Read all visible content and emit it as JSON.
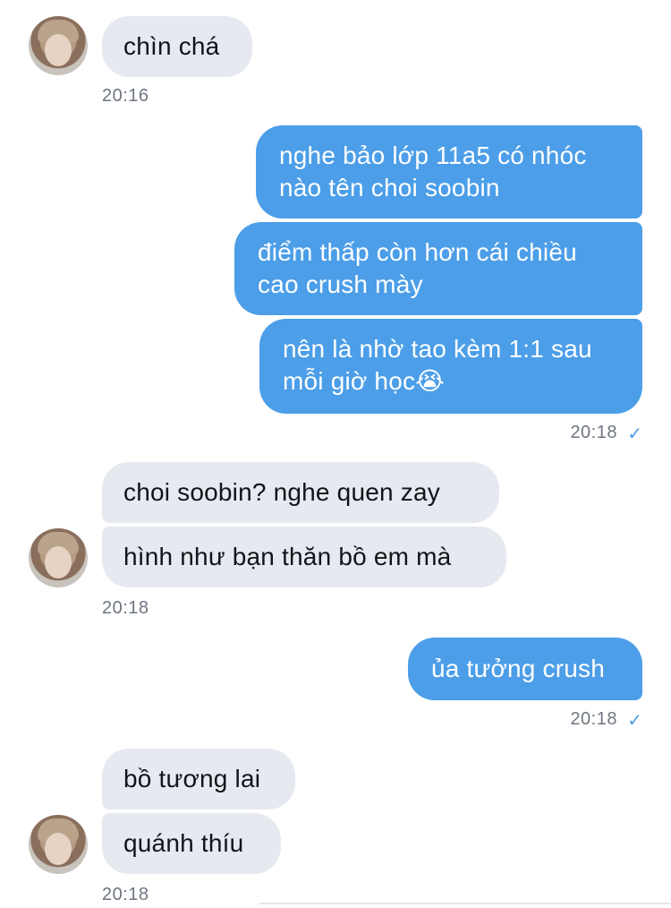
{
  "messages": [
    {
      "text": "chìn chá"
    },
    {
      "time": "20:16"
    },
    {
      "text": "nghe bảo lớp 11a5 có nhóc nào tên choi soobin"
    },
    {
      "text": "điểm thấp còn hơn cái chiều cao crush mày"
    },
    {
      "text": "nên là nhờ tao kèm 1:1 sau mỗi giờ học😭"
    },
    {
      "time": "20:18"
    },
    {
      "text": "choi soobin? nghe quen zay"
    },
    {
      "text": "hình như bạn thăn bồ em mà"
    },
    {
      "time": "20:18"
    },
    {
      "text": "ủa tưởng crush"
    },
    {
      "time": "20:18"
    },
    {
      "text": "bồ tương lai"
    },
    {
      "text": "quánh thíu"
    },
    {
      "time": "20:18"
    }
  ],
  "lines": {
    "m2a": "nghe bảo lớp 11a5 có nhóc",
    "m2b": "nào tên choi soobin",
    "m3a": "điểm thấp còn hơn cái chiều",
    "m3b": "cao crush mày",
    "m4a": "nên là nhờ tao kèm 1:1 sau",
    "m4b": "mỗi giờ học😭"
  },
  "icons": {
    "read_check": "✓",
    "avatar": "contact-avatar-icon"
  },
  "colors": {
    "outgoing_bubble": "#4c9ee8",
    "incoming_bubble": "#e6e9ef",
    "timestamp": "#6f7680"
  }
}
